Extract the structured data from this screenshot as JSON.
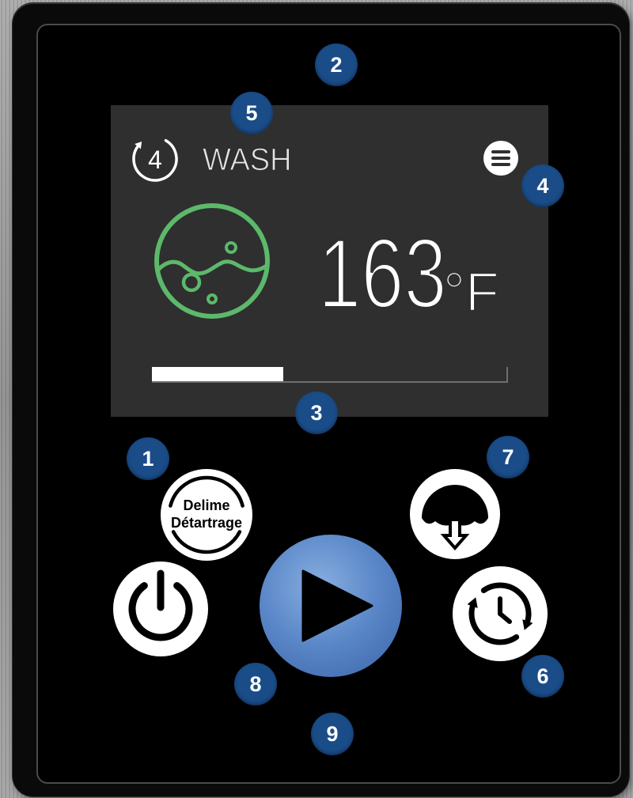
{
  "display": {
    "cycle_number": "4",
    "cycle_label": "WASH",
    "temperature_value": "163",
    "temperature_unit": "°F",
    "progress": 0.37
  },
  "buttons": {
    "delime_label": "Delime",
    "detartrage_label": "Détartrage"
  },
  "callouts": [
    "1",
    "2",
    "3",
    "4",
    "5",
    "6",
    "7",
    "8",
    "9"
  ],
  "icons": {
    "cycle_step": "cycle-step-icon",
    "menu": "menu-icon",
    "wash": "wash-water-icon",
    "delime": "delime-icon",
    "power": "power-icon",
    "start": "play-icon",
    "drain": "drain-icon",
    "cycle_timer": "cycle-timer-icon"
  },
  "colors": {
    "panel": "#0a0a0a",
    "screen": "#2f2f2f",
    "wash_green": "#5cb96b",
    "callout_blue": "#1a4c88",
    "start_blue": "#5a87c8",
    "button_white": "#ffffff"
  }
}
